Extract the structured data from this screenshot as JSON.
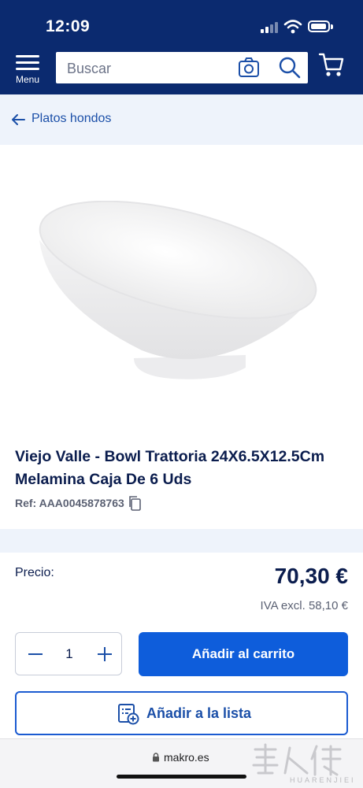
{
  "status_bar": {
    "time": "12:09"
  },
  "header": {
    "menu_label": "Menu",
    "search_placeholder": "Buscar"
  },
  "breadcrumb": {
    "label": "Platos hondos"
  },
  "product": {
    "title": "Viejo Valle - Bowl Trattoria 24X6.5X12.5Cm Melamina Caja De 6 Uds",
    "ref": "Ref: AAA0045878763",
    "price_label": "Precio:",
    "price": "70,30 €",
    "price_excl": "IVA excl. 58,10 €"
  },
  "actions": {
    "quantity": "1",
    "add_to_cart": "Añadir al carrito",
    "add_to_list": "Añadir a la lista"
  },
  "browser": {
    "url": "makro.es"
  },
  "watermark": {
    "text": "HUARENJIEI"
  },
  "colors": {
    "header_bg": "#0b2a6f",
    "primary_button": "#0e5ddb",
    "link": "#1b4fa8",
    "band_bg": "#eef3fb"
  }
}
